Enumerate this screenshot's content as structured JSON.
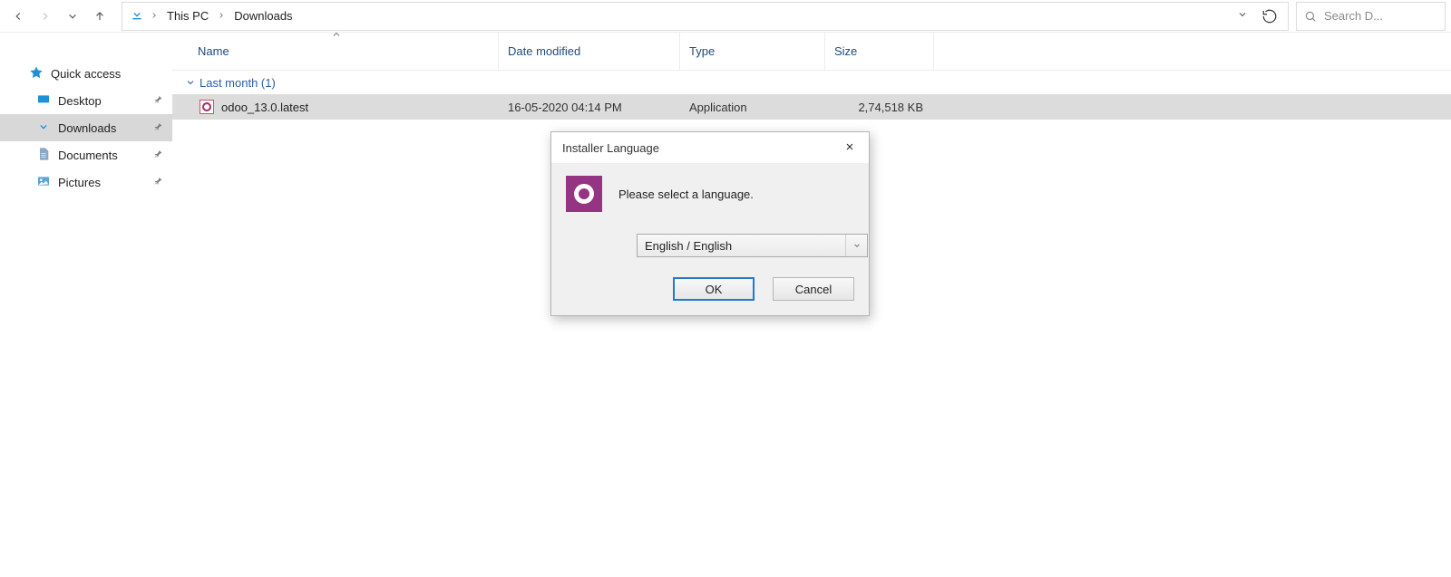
{
  "nav": {
    "path_parts": [
      "This PC",
      "Downloads"
    ]
  },
  "search": {
    "placeholder": "Search D..."
  },
  "sidebar": {
    "items": [
      {
        "label": "Quick access"
      },
      {
        "label": "Desktop"
      },
      {
        "label": "Downloads"
      },
      {
        "label": "Documents"
      },
      {
        "label": "Pictures"
      }
    ]
  },
  "columns": {
    "name": "Name",
    "date": "Date modified",
    "type": "Type",
    "size": "Size"
  },
  "group": {
    "label": "Last month (1)"
  },
  "files": [
    {
      "name": "odoo_13.0.latest",
      "date": "16-05-2020 04:14 PM",
      "type": "Application",
      "size": "2,74,518 KB"
    }
  ],
  "dialog": {
    "title": "Installer Language",
    "message": "Please select a language.",
    "selected": "English / English",
    "ok": "OK",
    "cancel": "Cancel"
  }
}
